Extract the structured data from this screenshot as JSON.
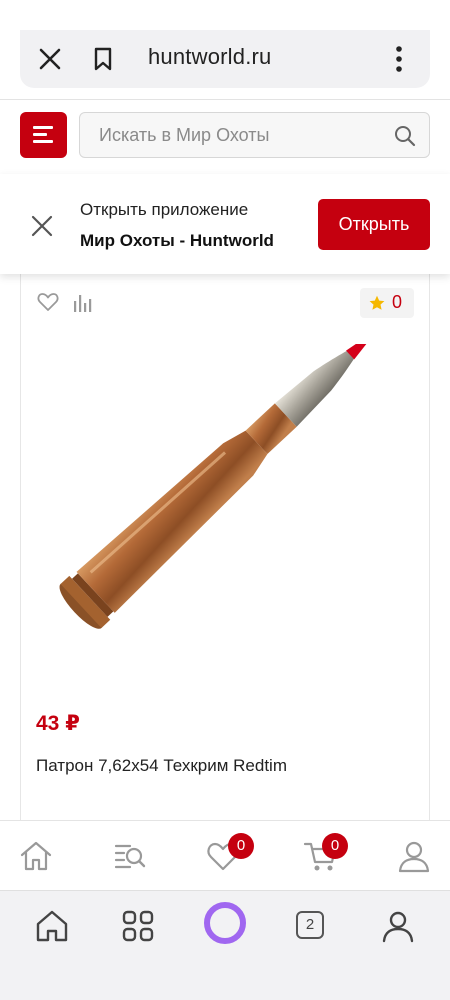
{
  "browser": {
    "url": "huntworld.ru",
    "tabs_count": "2"
  },
  "header": {
    "search_placeholder": "Искать в Мир Охоты"
  },
  "banner": {
    "line1": "Открыть приложение",
    "line2": "Мир Охоты - Huntworld",
    "open_label": "Открыть"
  },
  "product": {
    "rating": "0",
    "price": "43 ₽",
    "title": "Патрон 7,62x54 Техкрим Redtim"
  },
  "site_nav": {
    "favorites_count": "0",
    "cart_count": "0"
  },
  "colors": {
    "brand": "#c5000f",
    "badge": "#c5000f",
    "star": "#f5b800",
    "alice": "#a067f0"
  },
  "icons": {
    "browser": [
      "close-icon",
      "bookmark-icon",
      "more-vertical-icon"
    ],
    "site_nav": [
      "home-icon",
      "catalog-search-icon",
      "heart-icon",
      "cart-icon",
      "user-icon"
    ],
    "browser_nav": [
      "home-icon",
      "apps-grid-icon",
      "alice-icon",
      "tabs-icon",
      "profile-icon"
    ]
  }
}
